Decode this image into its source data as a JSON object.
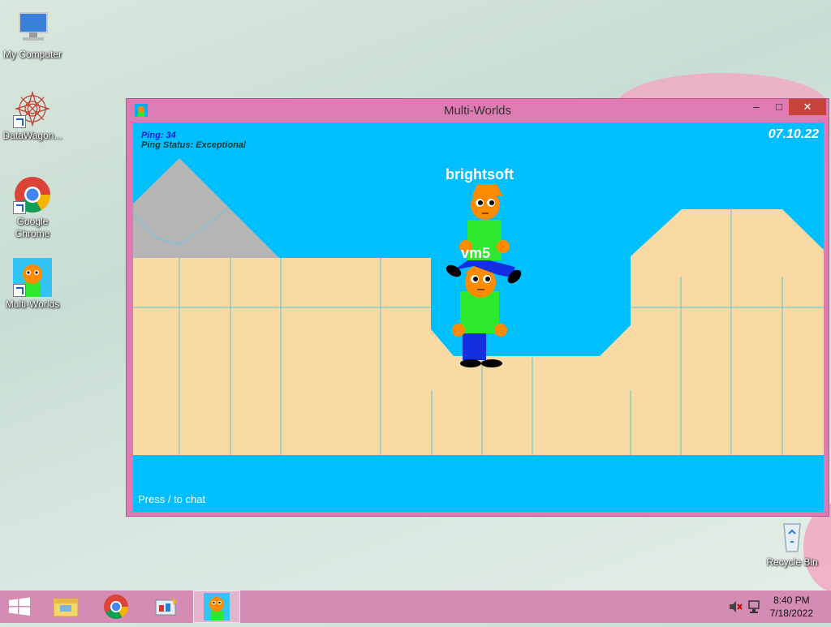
{
  "desktop": {
    "icons": [
      {
        "label": "My Computer"
      },
      {
        "label": "DataWagon..."
      },
      {
        "label": "Google Chrome"
      },
      {
        "label": "Multi-Worlds"
      },
      {
        "label": "Recycle Bin"
      }
    ]
  },
  "window": {
    "title": "Multi-Worlds",
    "minimize_glyph": "–",
    "maximize_glyph": "□",
    "close_glyph": "✕"
  },
  "game": {
    "ping_label": "Ping: 34",
    "ping_status": "Ping Status: Exceptional",
    "date": "07.10.22",
    "chat_hint": "Press / to chat",
    "players": [
      {
        "name": "brightsoft"
      },
      {
        "name": "vm5"
      }
    ],
    "colors": {
      "sky": "#00bfff",
      "sand": "#f9d9a4",
      "stone": "#b5b5b5",
      "shirt": "#2ee82e",
      "pants": "#1230e0",
      "head": "#ff8c00"
    }
  },
  "taskbar": {
    "items": [
      "start-icon",
      "file-explorer-icon",
      "chrome-icon",
      "control-panel-icon",
      "multi-worlds-icon"
    ],
    "time": "8:40 PM",
    "date": "7/18/2022"
  }
}
